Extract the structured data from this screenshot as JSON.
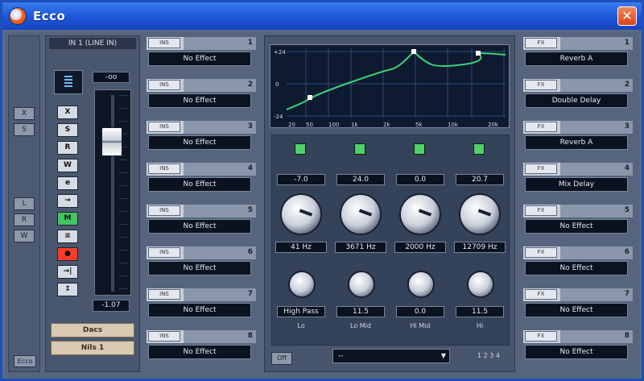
{
  "window": {
    "title": "Ecco",
    "close_label": "✕"
  },
  "left_strip": {
    "buttons": [
      "X",
      "S",
      "L",
      "R",
      "W"
    ],
    "bottom_button": "Ecco"
  },
  "channel": {
    "name": "IN 1 (LINE IN)",
    "volume_readout": "-oo",
    "fader_readout": "-1.07",
    "fader_level": 0.79,
    "strip_buttons": [
      "X",
      "S",
      "R",
      "W",
      "e",
      "→",
      "M",
      "≡",
      "●",
      "→|",
      "↕"
    ],
    "button_colors": {
      "green": "#42c45e",
      "red": "#ff3a2a"
    },
    "bottom_buttons": [
      "Dacs",
      "Nils 1"
    ]
  },
  "insert_slots": [
    {
      "number": "1",
      "value": "No Effect"
    },
    {
      "number": "2",
      "value": "No Effect"
    },
    {
      "number": "3",
      "value": "No Effect"
    },
    {
      "number": "4",
      "value": "No Effect"
    },
    {
      "number": "5",
      "value": "No Effect"
    },
    {
      "number": "6",
      "value": "No Effect"
    },
    {
      "number": "7",
      "value": "No Effect"
    },
    {
      "number": "8",
      "value": "No Effect"
    }
  ],
  "send_slots": [
    {
      "number": "1",
      "value": "Reverb A"
    },
    {
      "number": "2",
      "value": "Double Delay"
    },
    {
      "number": "3",
      "value": "Reverb A"
    },
    {
      "number": "4",
      "value": "Mix Delay"
    },
    {
      "number": "5",
      "value": "No Effect"
    },
    {
      "number": "6",
      "value": "No Effect"
    },
    {
      "number": "7",
      "value": "No Effect"
    },
    {
      "number": "8",
      "value": "No Effect"
    }
  ],
  "eq": {
    "graph_y_labels": [
      "+24",
      "0",
      "-24"
    ],
    "graph_x_labels": [
      "20",
      "50",
      "100",
      "1k",
      "2k",
      "5k",
      "10k",
      "20k"
    ],
    "bands": [
      {
        "toggle": "on",
        "gain": "-7.0",
        "freq": "41 Hz",
        "q": "High Pass",
        "label": "Lo"
      },
      {
        "toggle": "on",
        "gain": "24.0",
        "freq": "3671 Hz",
        "q": "11.5",
        "label": "Lo Mid"
      },
      {
        "toggle": "on",
        "gain": "0.0",
        "freq": "2000 Hz",
        "q": "0.0",
        "label": "Hi Mid"
      },
      {
        "toggle": "on",
        "gain": "20.7",
        "freq": "12709 Hz",
        "q": "11.5",
        "label": "Hi"
      }
    ],
    "bottom_button": "Off",
    "preset": "--",
    "tags": "1 2 3 4"
  }
}
